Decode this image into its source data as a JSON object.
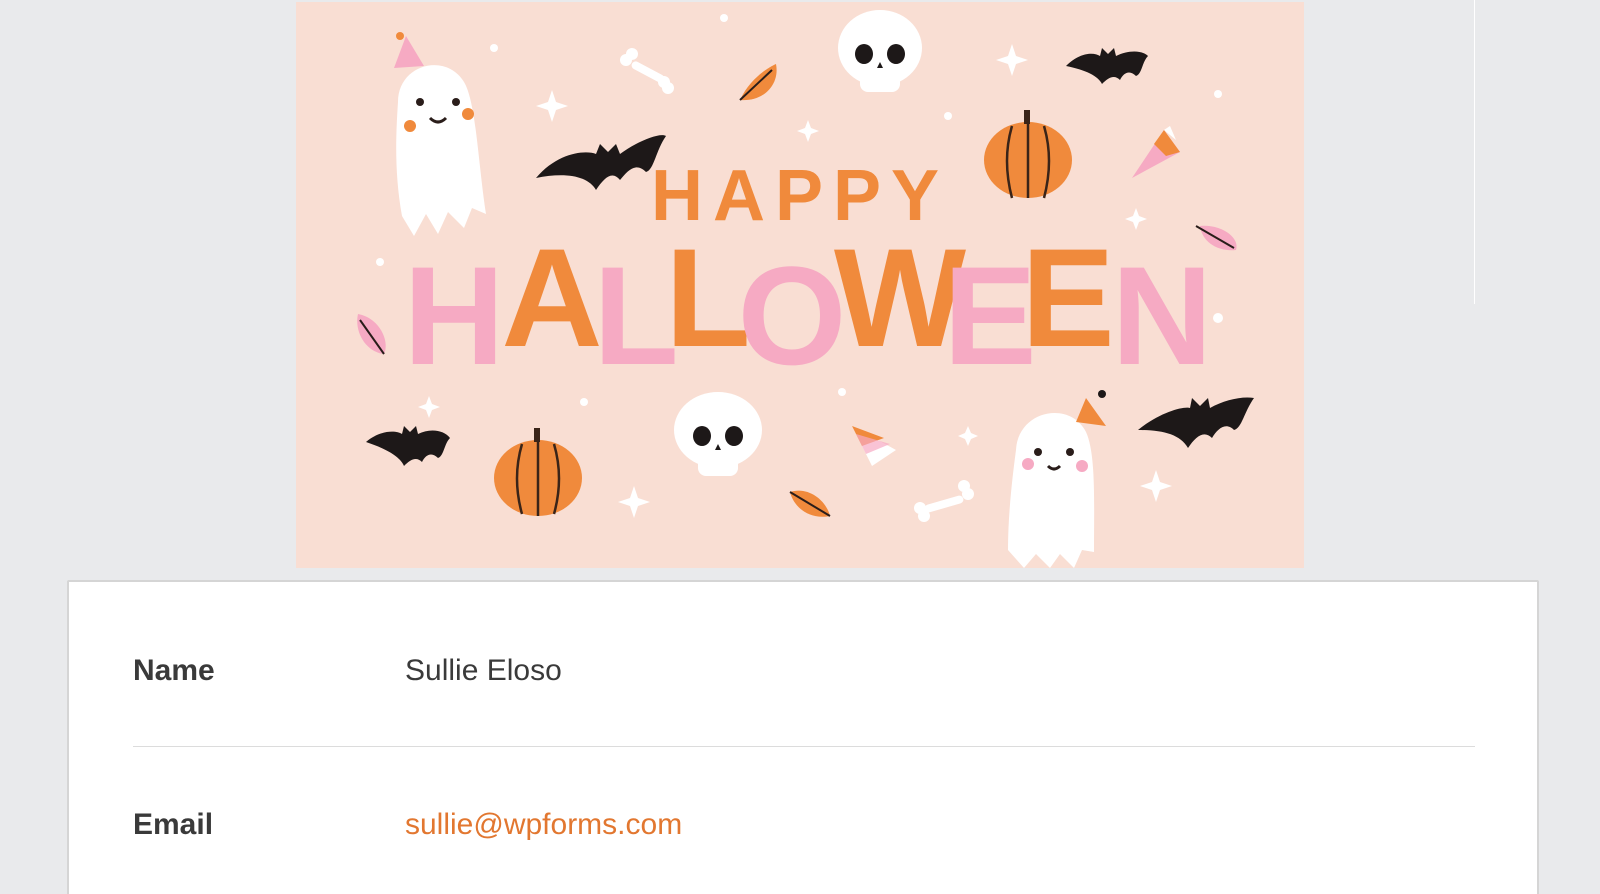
{
  "banner": {
    "line1": "HAPPY",
    "line2_letters": [
      "H",
      "A",
      "L",
      "L",
      "O",
      "W",
      "E",
      "E",
      "N"
    ],
    "background_color": "#f9ded3",
    "orange": "#f08a3c",
    "pink": "#f6aac3"
  },
  "entry": {
    "fields": [
      {
        "label": "Name",
        "value": "Sullie Eloso"
      },
      {
        "label": "Email",
        "value": "sullie@wpforms.com"
      }
    ]
  },
  "colors": {
    "page_bg": "#e9eaec",
    "card_bg": "#ffffff",
    "label": "#3a3a3a",
    "link": "#e27730"
  }
}
